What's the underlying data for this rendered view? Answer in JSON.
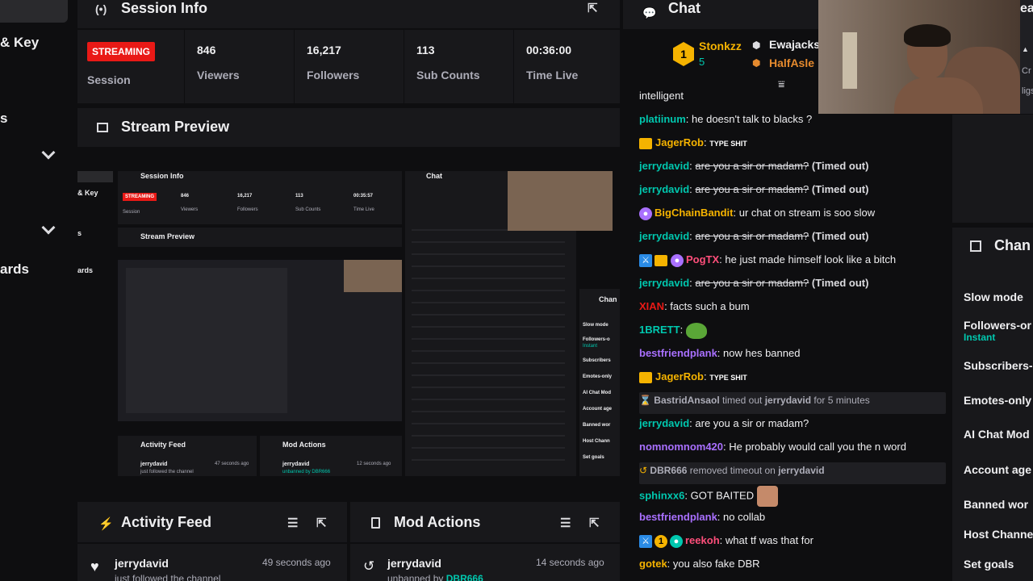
{
  "sidebar": {
    "items": [
      {
        "label": "& Key"
      },
      {
        "label": "s"
      },
      {
        "label": "ards"
      }
    ]
  },
  "session": {
    "title": "Session Info",
    "badge": "STREAMING",
    "badge_label": "Session",
    "stats": [
      {
        "value": "846",
        "label": "Viewers"
      },
      {
        "value": "16,217",
        "label": "Followers"
      },
      {
        "value": "113",
        "label": "Sub Counts"
      },
      {
        "value": "00:36:00",
        "label": "Time Live"
      }
    ]
  },
  "preview": {
    "title": "Stream Preview",
    "nested": {
      "title": "Session Info",
      "badge": "STREAMING",
      "badge_label": "Session",
      "stats": [
        {
          "value": "846",
          "label": "Viewers"
        },
        {
          "value": "16,217",
          "label": "Followers"
        },
        {
          "value": "113",
          "label": "Sub Counts"
        },
        {
          "value": "00:35:57",
          "label": "Time Live"
        }
      ],
      "preview_title": "Stream Preview",
      "chat_title": "Chat",
      "activity_title": "Activity Feed",
      "mod_title": "Mod Actions",
      "activity_user": "jerrydavid",
      "activity_time": "47 seconds ago",
      "activity_text": "just followed the channel",
      "mod_user": "jerrydavid",
      "mod_time": "12 seconds ago",
      "mod_text": "unbanned by DBR666",
      "side_key": "& Key",
      "side_s": "s",
      "side_ards": "ards",
      "chan_label": "Chan",
      "settings": [
        "Slow mode",
        "Followers-o",
        "Instant",
        "Subscribers",
        "Emotes-only",
        "AI Chat Mod",
        "Account age",
        "Banned wor",
        "Host Chann",
        "Set goals"
      ]
    }
  },
  "activity": {
    "title": "Activity Feed",
    "items": [
      {
        "user": "jerrydavid",
        "time": "49 seconds ago",
        "text": "just followed the channel"
      }
    ]
  },
  "mod_actions": {
    "title": "Mod Actions",
    "items": [
      {
        "user": "jerrydavid",
        "time": "14 seconds ago",
        "text": "unbanned by",
        "by": "DBR666"
      }
    ]
  },
  "chat": {
    "title": "Chat",
    "top": {
      "leader_name": "Stonkzz",
      "leader_count": "5",
      "second_name": "Ewajacks",
      "third_name": "HalfAsle"
    },
    "messages": [
      {
        "user": "",
        "text": "intelligent"
      },
      {
        "user": "platiinum",
        "color": "#00c8af",
        "text": "he doesn't talk to blacks ?"
      },
      {
        "user": "JagerRob",
        "color": "#f5b300",
        "text": "",
        "emote": "TYPE SHIT",
        "crown": true
      },
      {
        "user": "jerrydavid",
        "color": "#00c8af",
        "strike": "are you a sir or madam?",
        "tail": "(Timed out)"
      },
      {
        "user": "jerrydavid",
        "color": "#00c8af",
        "strike": "are you a sir or madam?",
        "tail": "(Timed out)"
      },
      {
        "user": "BigChainBandit",
        "color": "#f5b300",
        "text": "ur chat on stream is soo slow"
      },
      {
        "user": "jerrydavid",
        "color": "#00c8af",
        "strike": "are you a sir or madam?",
        "tail": "(Timed out)"
      },
      {
        "user": "PogTX",
        "color": "#ff4f7b",
        "text": "he just made himself look like a bitch"
      },
      {
        "user": "jerrydavid",
        "color": "#00c8af",
        "strike": "are you a sir or madam?",
        "tail": "(Timed out)"
      },
      {
        "user": "XIAN",
        "color": "#e91916",
        "text": "facts such a bum"
      },
      {
        "user": "1BRETT",
        "color": "#00c8af",
        "text": ""
      },
      {
        "user": "bestfriendplank",
        "color": "#a970ff",
        "text": "now hes banned"
      },
      {
        "user": "JagerRob",
        "color": "#f5b300",
        "text": "",
        "emote": "TYPE SHIT"
      },
      {
        "system_user": "BastridAnsaol",
        "system_text": "timed out",
        "system_target": "jerrydavid",
        "system_tail": "for 5 minutes"
      },
      {
        "user": "jerrydavid",
        "color": "#00c8af",
        "text": "are you a sir or madam?"
      },
      {
        "user": "nomnomnom420",
        "color": "#a970ff",
        "text": "He probably would call you the n word"
      },
      {
        "system_user": "DBR666",
        "system_text": "removed timeout on",
        "system_target": "jerrydavid"
      },
      {
        "user": "sphinxx6",
        "color": "#00c8af",
        "text": "GOT BAITED"
      },
      {
        "user": "bestfriendplank",
        "color": "#a970ff",
        "text": "no collab"
      },
      {
        "user": "reekoh",
        "color": "#ff4f7b",
        "text": "what tf was that for"
      },
      {
        "user": "gotek",
        "color": "#f5b300",
        "text": "you also fake DBR"
      }
    ]
  },
  "mod_settings": {
    "title": "Chan",
    "items": [
      {
        "label": "Slow mode"
      },
      {
        "label": "Followers-or",
        "sub": "Instant"
      },
      {
        "label": "Subscribers-"
      },
      {
        "label": "Emotes-only"
      },
      {
        "label": "AI Chat Mod"
      },
      {
        "label": "Account age"
      },
      {
        "label": "Banned wor"
      },
      {
        "label": "Host Channe"
      },
      {
        "label": "Set goals"
      }
    ]
  },
  "right_edge": {
    "top": "ea",
    "cut1": "Cr",
    "cut2": "ligs"
  },
  "colors": {
    "accent_live": "#e91916",
    "panel": "#18181b",
    "bg": "#0e0e10",
    "instant": "#00c8af"
  }
}
